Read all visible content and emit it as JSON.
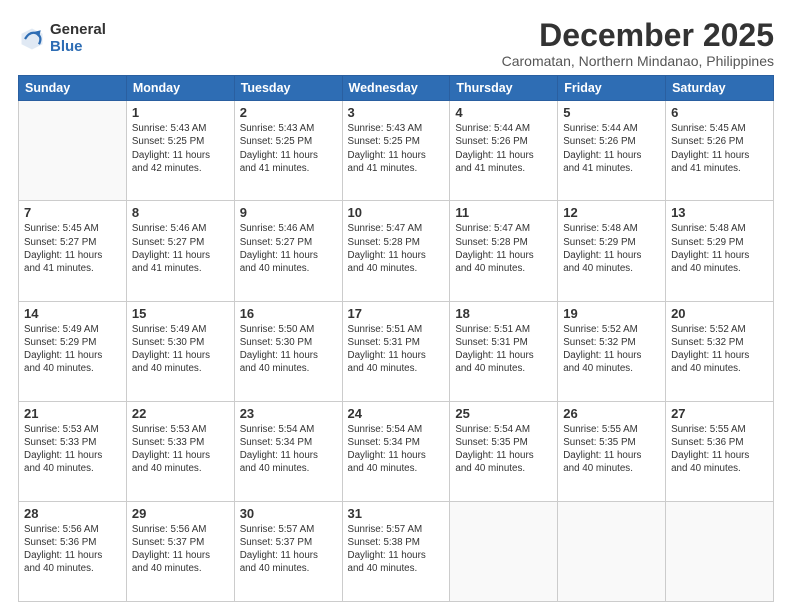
{
  "logo": {
    "general": "General",
    "blue": "Blue"
  },
  "header": {
    "month": "December 2025",
    "location": "Caromatan, Northern Mindanao, Philippines"
  },
  "weekdays": [
    "Sunday",
    "Monday",
    "Tuesday",
    "Wednesday",
    "Thursday",
    "Friday",
    "Saturday"
  ],
  "weeks": [
    [
      {
        "day": "",
        "info": ""
      },
      {
        "day": "1",
        "info": "Sunrise: 5:43 AM\nSunset: 5:25 PM\nDaylight: 11 hours\nand 42 minutes."
      },
      {
        "day": "2",
        "info": "Sunrise: 5:43 AM\nSunset: 5:25 PM\nDaylight: 11 hours\nand 41 minutes."
      },
      {
        "day": "3",
        "info": "Sunrise: 5:43 AM\nSunset: 5:25 PM\nDaylight: 11 hours\nand 41 minutes."
      },
      {
        "day": "4",
        "info": "Sunrise: 5:44 AM\nSunset: 5:26 PM\nDaylight: 11 hours\nand 41 minutes."
      },
      {
        "day": "5",
        "info": "Sunrise: 5:44 AM\nSunset: 5:26 PM\nDaylight: 11 hours\nand 41 minutes."
      },
      {
        "day": "6",
        "info": "Sunrise: 5:45 AM\nSunset: 5:26 PM\nDaylight: 11 hours\nand 41 minutes."
      }
    ],
    [
      {
        "day": "7",
        "info": "Sunrise: 5:45 AM\nSunset: 5:27 PM\nDaylight: 11 hours\nand 41 minutes."
      },
      {
        "day": "8",
        "info": "Sunrise: 5:46 AM\nSunset: 5:27 PM\nDaylight: 11 hours\nand 41 minutes."
      },
      {
        "day": "9",
        "info": "Sunrise: 5:46 AM\nSunset: 5:27 PM\nDaylight: 11 hours\nand 40 minutes."
      },
      {
        "day": "10",
        "info": "Sunrise: 5:47 AM\nSunset: 5:28 PM\nDaylight: 11 hours\nand 40 minutes."
      },
      {
        "day": "11",
        "info": "Sunrise: 5:47 AM\nSunset: 5:28 PM\nDaylight: 11 hours\nand 40 minutes."
      },
      {
        "day": "12",
        "info": "Sunrise: 5:48 AM\nSunset: 5:29 PM\nDaylight: 11 hours\nand 40 minutes."
      },
      {
        "day": "13",
        "info": "Sunrise: 5:48 AM\nSunset: 5:29 PM\nDaylight: 11 hours\nand 40 minutes."
      }
    ],
    [
      {
        "day": "14",
        "info": "Sunrise: 5:49 AM\nSunset: 5:29 PM\nDaylight: 11 hours\nand 40 minutes."
      },
      {
        "day": "15",
        "info": "Sunrise: 5:49 AM\nSunset: 5:30 PM\nDaylight: 11 hours\nand 40 minutes."
      },
      {
        "day": "16",
        "info": "Sunrise: 5:50 AM\nSunset: 5:30 PM\nDaylight: 11 hours\nand 40 minutes."
      },
      {
        "day": "17",
        "info": "Sunrise: 5:51 AM\nSunset: 5:31 PM\nDaylight: 11 hours\nand 40 minutes."
      },
      {
        "day": "18",
        "info": "Sunrise: 5:51 AM\nSunset: 5:31 PM\nDaylight: 11 hours\nand 40 minutes."
      },
      {
        "day": "19",
        "info": "Sunrise: 5:52 AM\nSunset: 5:32 PM\nDaylight: 11 hours\nand 40 minutes."
      },
      {
        "day": "20",
        "info": "Sunrise: 5:52 AM\nSunset: 5:32 PM\nDaylight: 11 hours\nand 40 minutes."
      }
    ],
    [
      {
        "day": "21",
        "info": "Sunrise: 5:53 AM\nSunset: 5:33 PM\nDaylight: 11 hours\nand 40 minutes."
      },
      {
        "day": "22",
        "info": "Sunrise: 5:53 AM\nSunset: 5:33 PM\nDaylight: 11 hours\nand 40 minutes."
      },
      {
        "day": "23",
        "info": "Sunrise: 5:54 AM\nSunset: 5:34 PM\nDaylight: 11 hours\nand 40 minutes."
      },
      {
        "day": "24",
        "info": "Sunrise: 5:54 AM\nSunset: 5:34 PM\nDaylight: 11 hours\nand 40 minutes."
      },
      {
        "day": "25",
        "info": "Sunrise: 5:54 AM\nSunset: 5:35 PM\nDaylight: 11 hours\nand 40 minutes."
      },
      {
        "day": "26",
        "info": "Sunrise: 5:55 AM\nSunset: 5:35 PM\nDaylight: 11 hours\nand 40 minutes."
      },
      {
        "day": "27",
        "info": "Sunrise: 5:55 AM\nSunset: 5:36 PM\nDaylight: 11 hours\nand 40 minutes."
      }
    ],
    [
      {
        "day": "28",
        "info": "Sunrise: 5:56 AM\nSunset: 5:36 PM\nDaylight: 11 hours\nand 40 minutes."
      },
      {
        "day": "29",
        "info": "Sunrise: 5:56 AM\nSunset: 5:37 PM\nDaylight: 11 hours\nand 40 minutes."
      },
      {
        "day": "30",
        "info": "Sunrise: 5:57 AM\nSunset: 5:37 PM\nDaylight: 11 hours\nand 40 minutes."
      },
      {
        "day": "31",
        "info": "Sunrise: 5:57 AM\nSunset: 5:38 PM\nDaylight: 11 hours\nand 40 minutes."
      },
      {
        "day": "",
        "info": ""
      },
      {
        "day": "",
        "info": ""
      },
      {
        "day": "",
        "info": ""
      }
    ]
  ]
}
